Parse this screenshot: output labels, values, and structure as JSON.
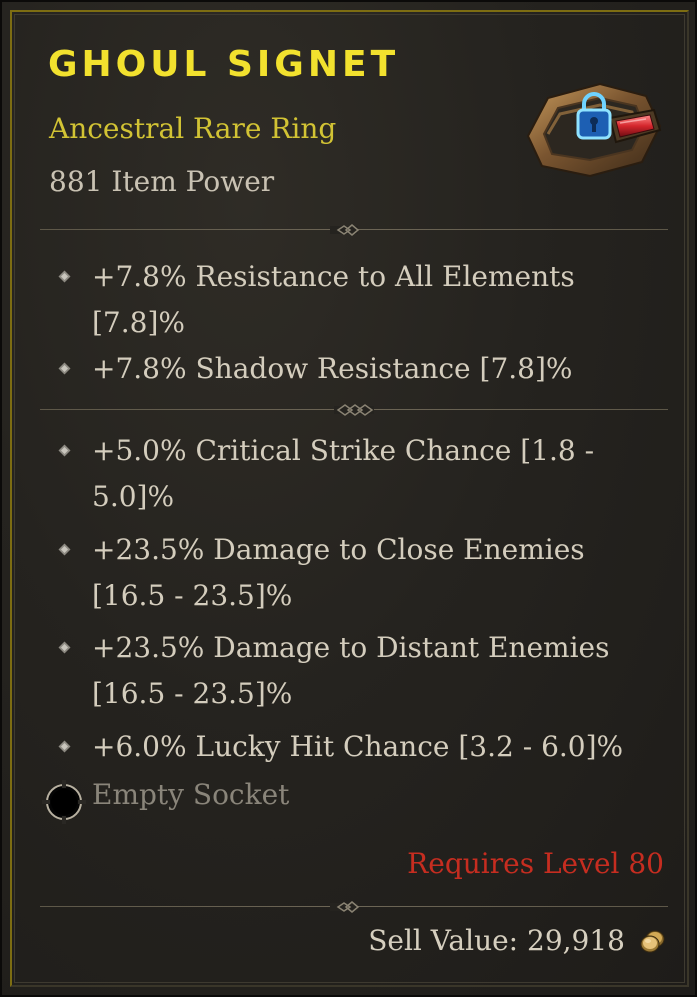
{
  "item": {
    "name": "GHOUL SIGNET",
    "type": "Ancestral Rare Ring",
    "item_power": "881 Item Power",
    "image_icon": "ring-icon",
    "lock_icon": "padlock-icon",
    "rarity_color": "#f2e12e"
  },
  "implicit_affixes": [
    {
      "text": "+7.8% Resistance to All Elements [7.8]%"
    },
    {
      "text": "+7.8% Shadow Resistance [7.8]%"
    }
  ],
  "affixes": [
    {
      "text": "+5.0% Critical Strike Chance [1.8 - 5.0]%"
    },
    {
      "text": "+23.5% Damage to Close Enemies [16.5 - 23.5]%"
    },
    {
      "text": "+23.5% Damage to Distant Enemies [16.5 - 23.5]%"
    },
    {
      "text": "+6.0% Lucky Hit Chance [3.2 - 6.0]%"
    }
  ],
  "socket": {
    "label": "Empty Socket",
    "icon": "empty-socket-icon"
  },
  "requirement": {
    "text": "Requires Level 80",
    "color": "#c62d20"
  },
  "sell": {
    "text": "Sell Value: 29,918",
    "icon": "gold-coins-icon"
  }
}
